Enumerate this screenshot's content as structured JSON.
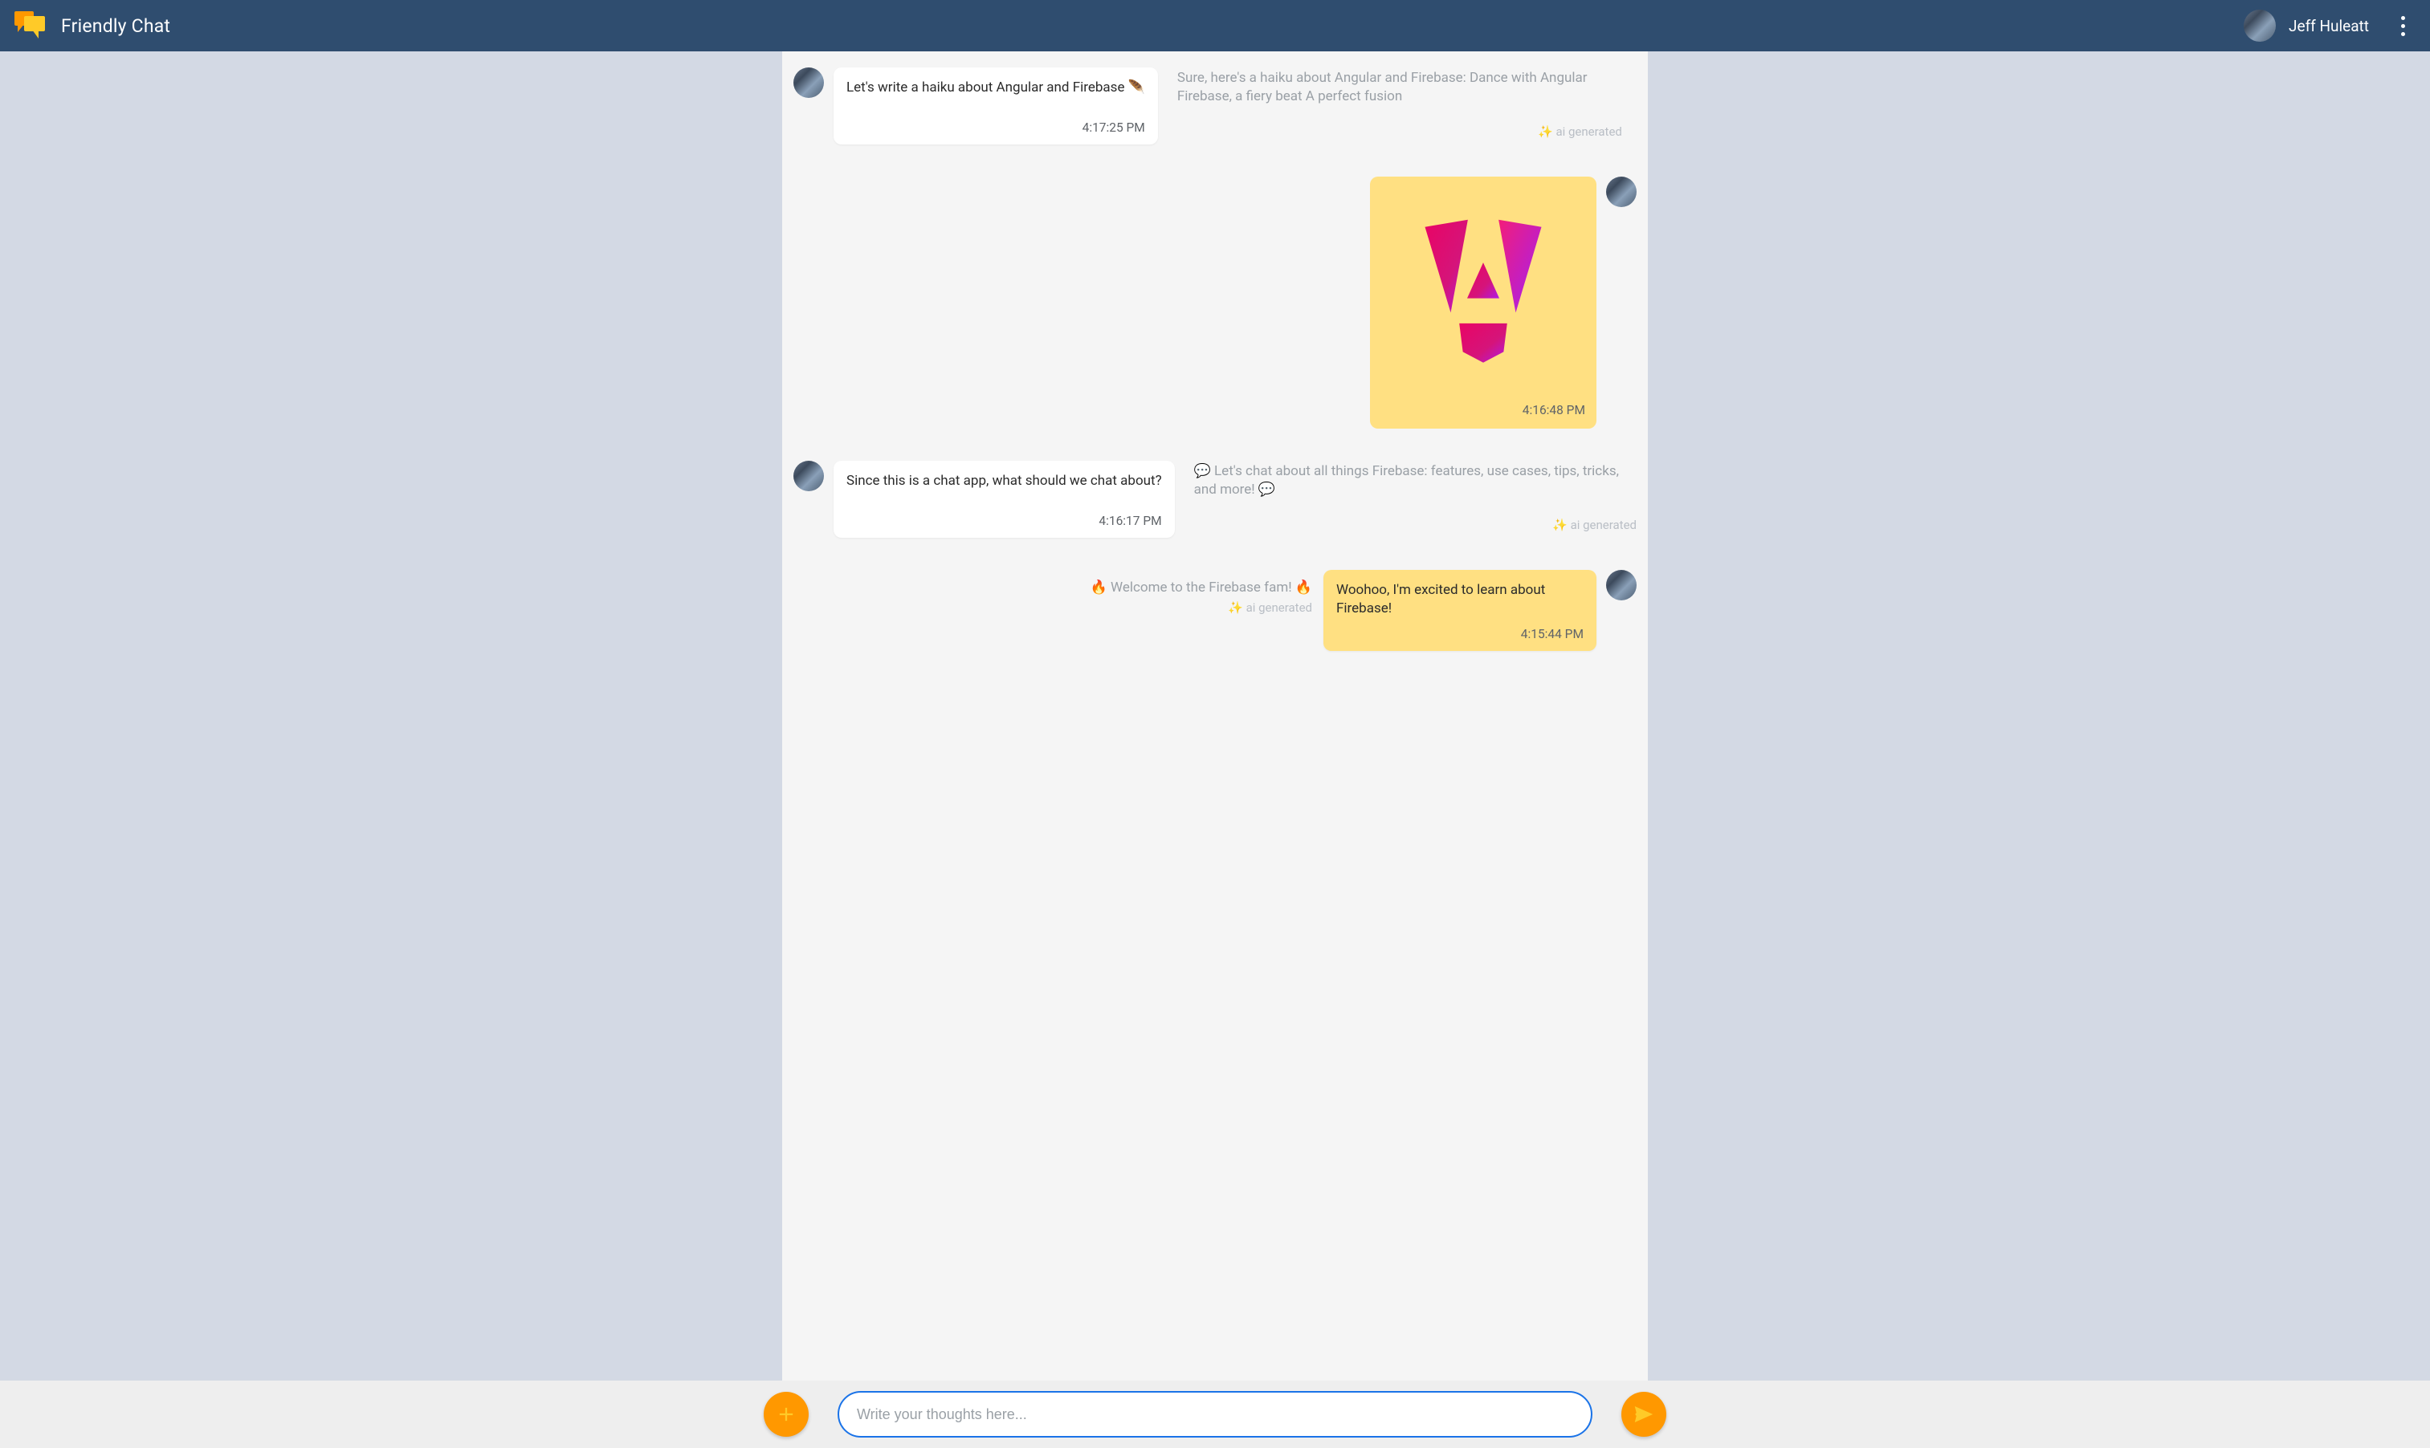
{
  "header": {
    "app_title": "Friendly Chat",
    "user_name": "Jeff Huleatt"
  },
  "messages": [
    {
      "id": "m1",
      "side": "left",
      "text": "Let's write a haiku about Angular and Firebase 🪶",
      "timestamp": "4:17:25 PM",
      "ai_response": "Sure, here's a haiku about Angular and Firebase: Dance with Angular Firebase, a fiery beat A perfect fusion",
      "ai_tag": "✨ ai generated"
    },
    {
      "id": "m2",
      "side": "right",
      "kind": "image",
      "image_alt": "angular-logo",
      "timestamp": "4:16:48 PM"
    },
    {
      "id": "m3",
      "side": "left",
      "text": "Since this is a chat app, what should we chat about?",
      "timestamp": "4:16:17 PM",
      "ai_response": "💬 Let's chat about all things Firebase: features, use cases, tips, tricks, and more! 💬",
      "ai_tag": "✨ ai generated"
    },
    {
      "id": "m4",
      "side": "right",
      "text": "Woohoo, I'm excited to learn about Firebase!",
      "timestamp": "4:15:44 PM",
      "greeting": "🔥 Welcome to the Firebase fam! 🔥",
      "ai_tag": "✨ ai generated"
    }
  ],
  "composer": {
    "placeholder": "Write your thoughts here..."
  }
}
